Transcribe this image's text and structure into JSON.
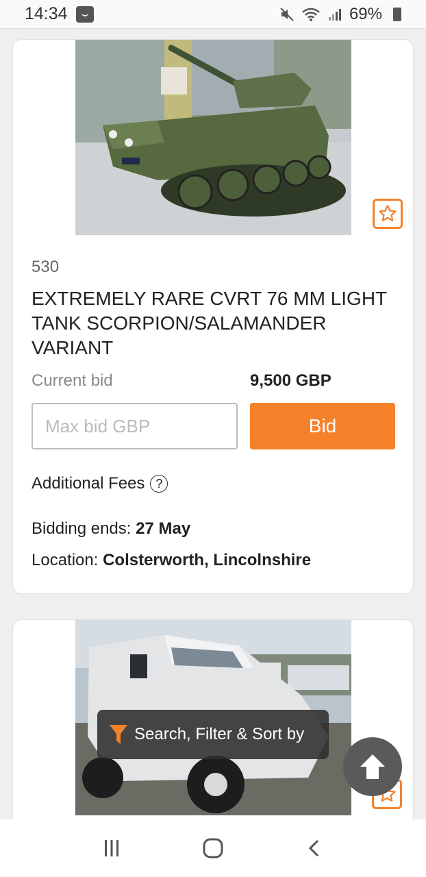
{
  "status_bar": {
    "time": "14:34",
    "battery": "69%"
  },
  "listings": [
    {
      "lot_number": "530",
      "title": "EXTREMELY RARE CVRT 76 MM LIGHT TANK SCORPION/SALAMANDER VARIANT",
      "current_bid_label": "Current bid",
      "current_bid_value": "9,500 GBP",
      "max_bid_placeholder": "Max bid GBP",
      "bid_button_label": "Bid",
      "additional_fees_label": "Additional Fees",
      "bidding_ends_label": "Bidding ends:",
      "bidding_ends_value": "27 May",
      "location_label": "Location:",
      "location_value": "Colsterworth, Lincolnshire"
    }
  ],
  "filter_bar": {
    "label": "Search, Filter & Sort by"
  },
  "colors": {
    "accent": "#f6812b",
    "fab": "#5a5a5a"
  },
  "icons": {
    "favorite": "star-icon",
    "filter": "funnel-icon",
    "scroll_top": "arrow-up-icon",
    "help": "question-circle-icon"
  }
}
